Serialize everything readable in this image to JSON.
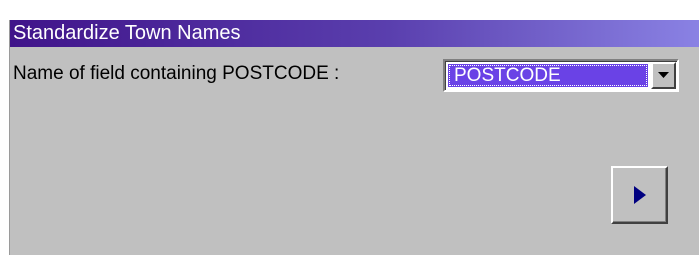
{
  "window": {
    "title": "Standardize Town Names"
  },
  "form": {
    "postcode_field_label": "Name of field containing POSTCODE :",
    "postcode_field_value": "POSTCODE",
    "dropdown_icon": "chevron-down-icon",
    "next_icon": "play-right-icon"
  },
  "colors": {
    "titlebar_start": "#40148a",
    "titlebar_end": "#8a82e4",
    "selection": "#6a42e6",
    "face": "#c0c0c0",
    "arrow": "#000080"
  }
}
